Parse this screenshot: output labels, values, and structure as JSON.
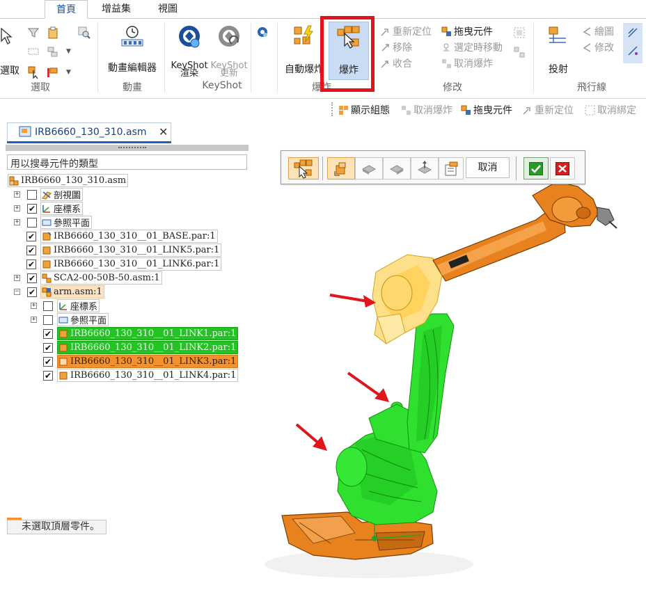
{
  "tabs": [
    {
      "label": "首頁",
      "active": true
    },
    {
      "label": "增益集",
      "active": false
    },
    {
      "label": "視圖",
      "active": false
    }
  ],
  "ribbon": {
    "select_label": "選取",
    "select_group": "選取",
    "animation_editor": "動畫編輯器",
    "animation_group": "動畫",
    "keyshot_render": "KeyShot 渲染",
    "keyshot_update": "KeyShot 更新",
    "keyshot_group": "KeyShot",
    "auto_explode": "自動爆炸",
    "explode": "爆炸",
    "explode_group": "爆炸",
    "modify_items": [
      {
        "label": "重新定位",
        "enabled": false
      },
      {
        "label": "拖曳元件",
        "enabled": true
      },
      {
        "label": "移除",
        "enabled": false
      },
      {
        "label": "選定時移動",
        "enabled": false
      },
      {
        "label": "收合",
        "enabled": false
      },
      {
        "label": "取消爆炸",
        "enabled": false
      }
    ],
    "modify_group": "修改",
    "project": "投射",
    "flyline_draw": "繪圖",
    "flyline_modify": "修改",
    "flyline_group": "飛行線"
  },
  "quickbar": [
    {
      "label": "顯示組態",
      "enabled": true
    },
    {
      "label": "取消爆炸",
      "enabled": false
    },
    {
      "label": "拖曳元件",
      "enabled": true
    },
    {
      "label": "重新定位",
      "enabled": false
    },
    {
      "label": "取消綁定",
      "enabled": false
    }
  ],
  "document": {
    "tab_title": "IRB6660_130_310.asm",
    "close": "✕"
  },
  "tree": {
    "search_placeholder": "用以搜尋元件的類型",
    "root": "IRB6660_130_310.asm",
    "rows": [
      {
        "label": "剖視圖",
        "checked": false,
        "expandable": true
      },
      {
        "label": "座標系",
        "checked": true,
        "expandable": true
      },
      {
        "label": "參照平面",
        "checked": false,
        "expandable": true
      },
      {
        "label": "IRB6660_130_310__01_BASE.par:1",
        "checked": true,
        "expandable": false
      },
      {
        "label": "IRB6660_130_310__01_LINK5.par:1",
        "checked": true,
        "expandable": false
      },
      {
        "label": "IRB6660_130_310__01_LINK6.par:1",
        "checked": true,
        "expandable": false
      },
      {
        "label": "SCA2-00-50B-50.asm:1",
        "checked": true,
        "expandable": true
      },
      {
        "label": "arm.asm:1",
        "checked": true,
        "expandable": true,
        "expanded": true
      }
    ],
    "children": [
      {
        "label": "座標系",
        "checked": false,
        "expandable": true
      },
      {
        "label": "參照平面",
        "checked": false,
        "expandable": true
      },
      {
        "label": "IRB6660_130_310__01_LINK1.par:1",
        "checked": true,
        "highlight": "green"
      },
      {
        "label": "IRB6660_130_310__01_LINK2.par:1",
        "checked": true,
        "highlight": "green"
      },
      {
        "label": "IRB6660_130_310__01_LINK3.par:1",
        "checked": true,
        "highlight": "orange"
      },
      {
        "label": "IRB6660_130_310__01_LINK4.par:1",
        "checked": true,
        "highlight": "none"
      }
    ],
    "status": "未選取頂層零件。"
  },
  "commandbar": {
    "cancel": "取消",
    "accept_icon": "check-icon",
    "cancel_icon": "x-icon"
  },
  "colors": {
    "accent_blue": "#1f5fbf",
    "highlight_red": "#e0141a",
    "selection_green": "#22c322",
    "robot_orange": "#e8821e",
    "arrow_red": "#e0141a"
  }
}
